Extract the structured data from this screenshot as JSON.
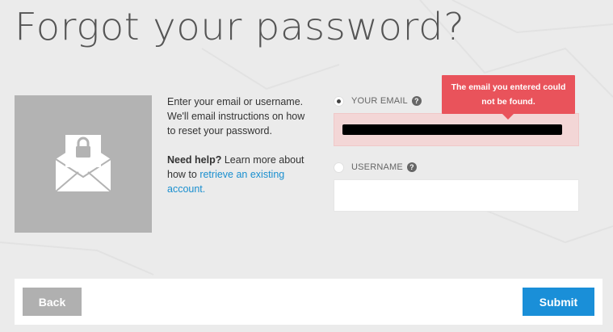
{
  "page": {
    "title": "Forgot your password?"
  },
  "info": {
    "instructions": "Enter your email or username. We'll email instructions on how to reset your password.",
    "help_bold": "Need help?",
    "help_text": " Learn more about how to ",
    "help_link": "retrieve an existing account."
  },
  "form": {
    "email_label": "YOUR EMAIL",
    "email_help_icon": "?",
    "email_value": "",
    "email_selected": true,
    "username_label": "USERNAME",
    "username_help_icon": "?",
    "username_value": "",
    "username_selected": false
  },
  "error": {
    "message": "The email you entered could not be found."
  },
  "footer": {
    "back_label": "Back",
    "submit_label": "Submit"
  },
  "colors": {
    "accent": "#1a8fd8",
    "error": "#e9535b",
    "error_bg": "#f3d6d6",
    "button_secondary": "#b0b0b0"
  }
}
